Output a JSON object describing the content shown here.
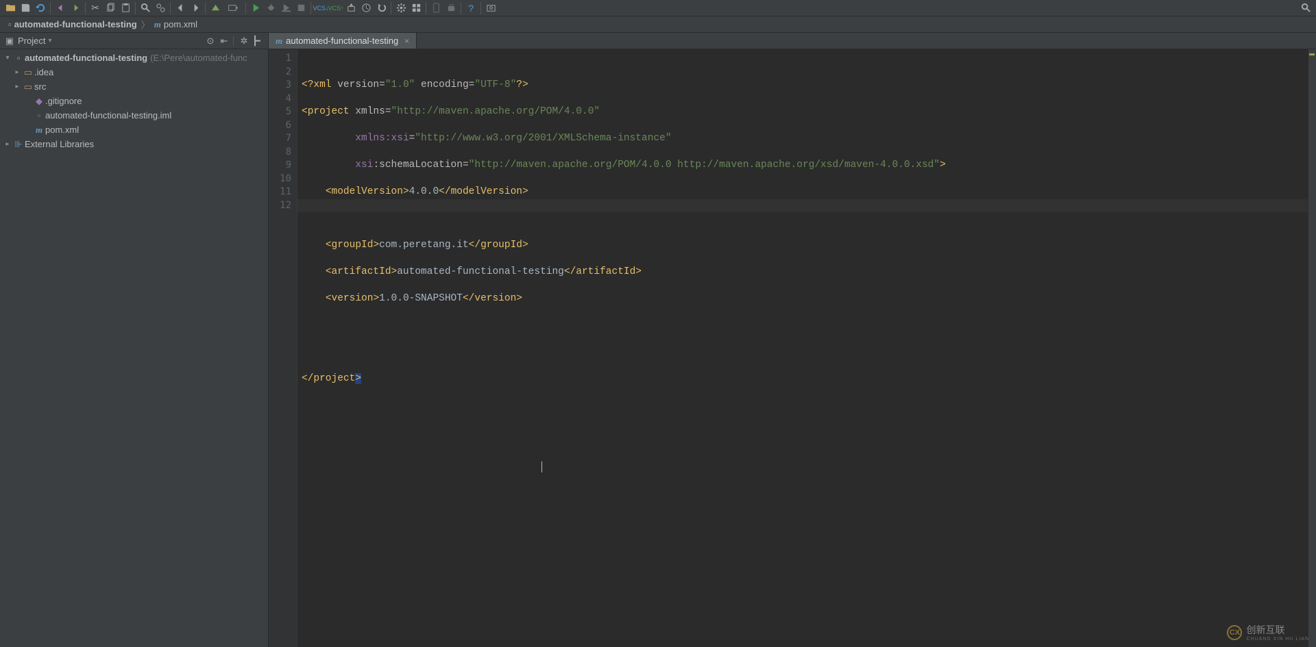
{
  "toolbar": {
    "icons": [
      "open",
      "save",
      "refresh",
      "undo",
      "redo",
      "cut",
      "copy",
      "paste",
      "find",
      "replace",
      "back",
      "forward",
      "build",
      "select-run",
      "run",
      "debug",
      "stop",
      "coverage",
      "vcs-update",
      "vcs-commit",
      "vcs-push",
      "vcs-history",
      "vcs-rollback",
      "settings",
      "structure",
      "avd",
      "sdk",
      "help",
      "screenshot"
    ],
    "search_right": "search"
  },
  "breadcrumb": {
    "project": "automated-functional-testing",
    "file_icon": "m",
    "file": "pom.xml"
  },
  "sidebar": {
    "header": {
      "view_icon": "project-view",
      "title": "Project",
      "buttons": [
        "target",
        "collapse",
        "settings",
        "minimize"
      ]
    },
    "tree": {
      "root": {
        "name": "automated-functional-testing",
        "path": "(E:\\Pere\\automated-func"
      },
      "items": [
        {
          "type": "dir",
          "name": ".idea",
          "expandable": true
        },
        {
          "type": "dir",
          "name": "src",
          "expandable": true
        },
        {
          "type": "file",
          "icon": "gi",
          "name": ".gitignore"
        },
        {
          "type": "file",
          "icon": "iml",
          "name": "automated-functional-testing.iml"
        },
        {
          "type": "file",
          "icon": "m",
          "name": "pom.xml"
        }
      ],
      "external": "External Libraries"
    }
  },
  "tab": {
    "icon": "m",
    "title": "automated-functional-testing"
  },
  "code": {
    "lines": 12,
    "current_line": 12,
    "l1": {
      "open": "<?",
      "tag": "xml",
      "a1": " version=",
      "v1": "\"1.0\"",
      "a2": " encoding=",
      "v2": "\"UTF-8\"",
      "close": "?>"
    },
    "l2": {
      "open": "<",
      "tag": "project",
      "a1": " xmlns=",
      "v1": "\"http://maven.apache.org/POM/4.0.0\""
    },
    "l3": {
      "ns": "xmlns:xsi",
      "eq": "=",
      "v": "\"http://www.w3.org/2001/XMLSchema-instance\""
    },
    "l4": {
      "ns": "xsi",
      "col": ":",
      "loc": "schemaLocation",
      "eq": "=",
      "v": "\"http://maven.apache.org/POM/4.0.0 http://maven.apache.org/xsd/maven-4.0.0.xsd\"",
      "close": ">"
    },
    "l5": {
      "o": "<",
      "t": "modelVersion",
      "c": ">",
      "x": "4.0.0",
      "o2": "</",
      "c2": ">"
    },
    "l7": {
      "o": "<",
      "t": "groupId",
      "c": ">",
      "x": "com.peretang.it",
      "o2": "</",
      "c2": ">"
    },
    "l8": {
      "o": "<",
      "t": "artifactId",
      "c": ">",
      "x": "automated-functional-testing",
      "o2": "</",
      "c2": ">"
    },
    "l9": {
      "o": "<",
      "t": "version",
      "c": ">",
      "x": "1.0.0-SNAPSHOT",
      "o2": "</",
      "c2": ">"
    },
    "l12": {
      "o": "</",
      "t": "project",
      "c": ">"
    }
  },
  "watermark": {
    "text": "创新互联",
    "sub": "CHUANG XIN HU LIAN"
  }
}
